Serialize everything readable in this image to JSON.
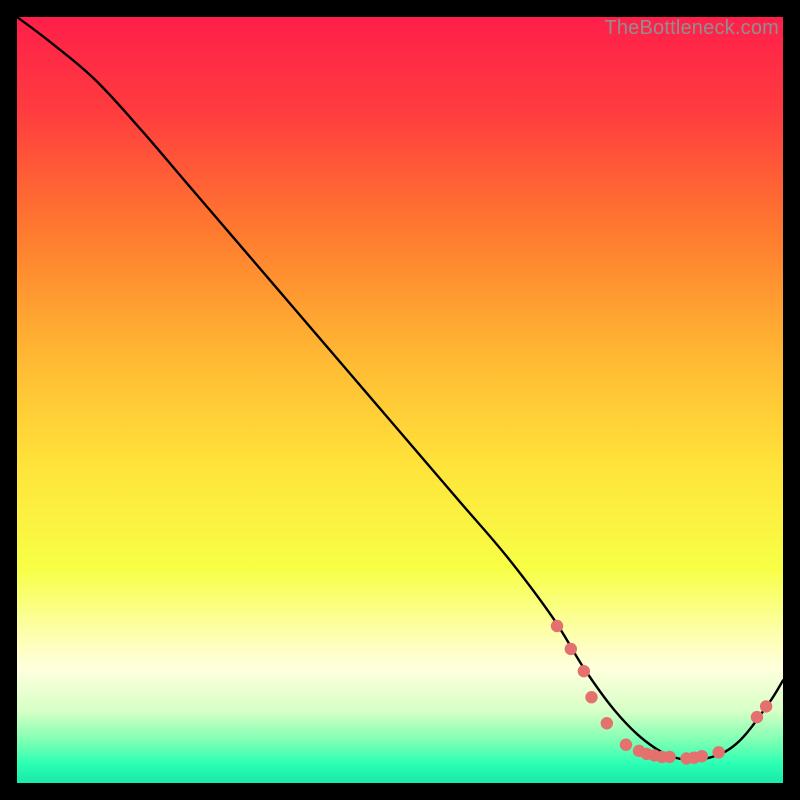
{
  "watermark": "TheBottleneck.com",
  "chart_data": {
    "type": "line",
    "title": "",
    "xlabel": "",
    "ylabel": "",
    "xlim": [
      0,
      100
    ],
    "ylim": [
      0,
      100
    ],
    "background_gradient": {
      "stops": [
        {
          "offset": 0.0,
          "color": "#ff1f4a"
        },
        {
          "offset": 0.12,
          "color": "#ff3b3f"
        },
        {
          "offset": 0.28,
          "color": "#ff7a2f"
        },
        {
          "offset": 0.44,
          "color": "#ffb733"
        },
        {
          "offset": 0.58,
          "color": "#ffe23a"
        },
        {
          "offset": 0.72,
          "color": "#f7ff45"
        },
        {
          "offset": 0.8,
          "color": "#fdffa6"
        },
        {
          "offset": 0.85,
          "color": "#ffffde"
        },
        {
          "offset": 0.905,
          "color": "#d8ffc6"
        },
        {
          "offset": 0.945,
          "color": "#7dffb3"
        },
        {
          "offset": 0.975,
          "color": "#2bffb4"
        },
        {
          "offset": 1.0,
          "color": "#18e9a8"
        }
      ]
    },
    "series": [
      {
        "name": "curve",
        "x": [
          0,
          4,
          10,
          16,
          22,
          28,
          34,
          40,
          46,
          52,
          58,
          64,
          70,
          74,
          78,
          82,
          86,
          90,
          94,
          98,
          100
        ],
        "y": [
          100,
          97,
          92,
          85.5,
          78.5,
          71.5,
          64.5,
          57.5,
          50.5,
          43.5,
          36.5,
          29.5,
          21.5,
          15,
          9.5,
          5.5,
          3.3,
          3.2,
          5.2,
          10.2,
          13.4
        ]
      }
    ],
    "markers": {
      "name": "highlight-points",
      "color": "#e4716d",
      "radius": 6.2,
      "points": [
        {
          "x": 70.5,
          "y": 20.5
        },
        {
          "x": 72.3,
          "y": 17.5
        },
        {
          "x": 74.0,
          "y": 14.6
        },
        {
          "x": 75.0,
          "y": 11.2
        },
        {
          "x": 77.0,
          "y": 7.8
        },
        {
          "x": 79.5,
          "y": 5.0
        },
        {
          "x": 81.2,
          "y": 4.2
        },
        {
          "x": 82.2,
          "y": 3.8
        },
        {
          "x": 83.2,
          "y": 3.6
        },
        {
          "x": 84.2,
          "y": 3.4
        },
        {
          "x": 85.2,
          "y": 3.4
        },
        {
          "x": 87.4,
          "y": 3.2
        },
        {
          "x": 88.4,
          "y": 3.3
        },
        {
          "x": 89.4,
          "y": 3.5
        },
        {
          "x": 91.6,
          "y": 4.0
        },
        {
          "x": 96.6,
          "y": 8.6
        },
        {
          "x": 97.8,
          "y": 10.0
        }
      ]
    }
  }
}
